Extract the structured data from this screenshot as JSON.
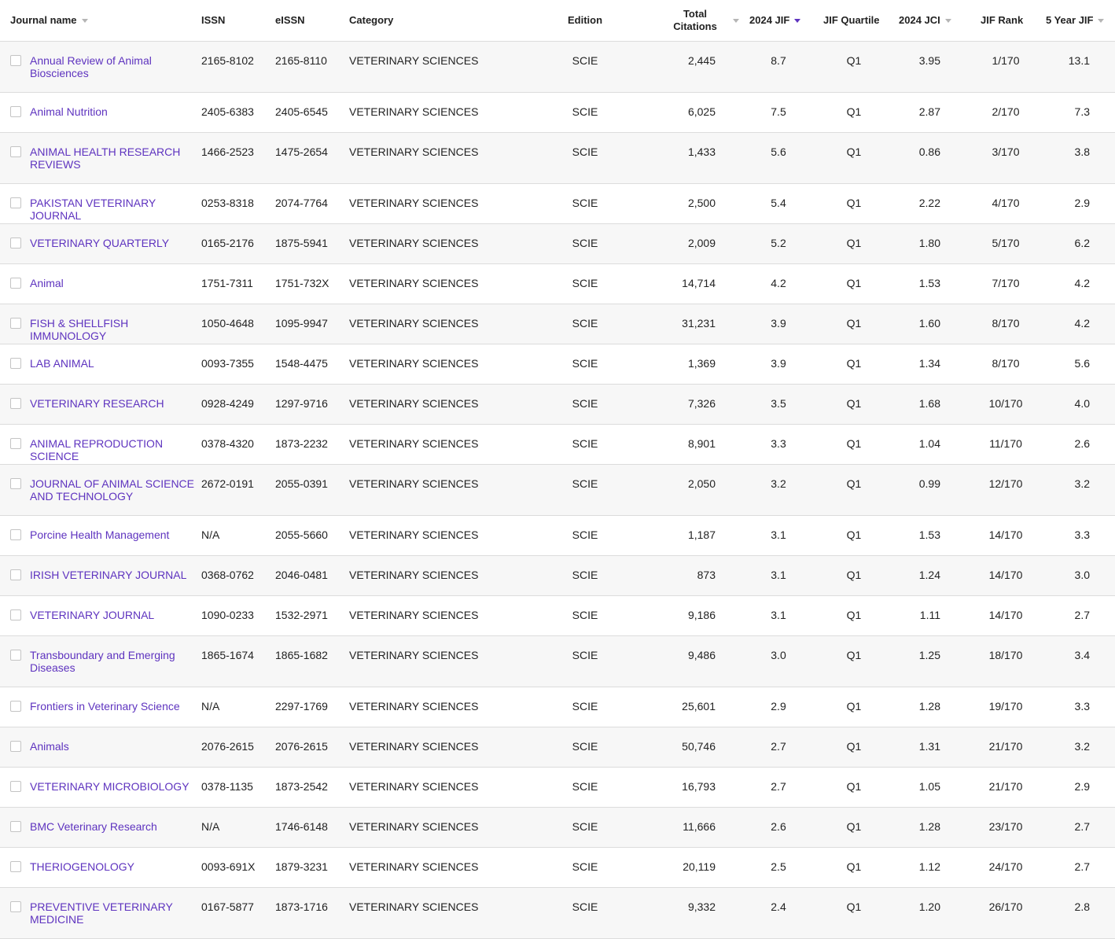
{
  "columns": {
    "journal_name": "Journal name",
    "issn": "ISSN",
    "eissn": "eISSN",
    "category": "Category",
    "edition": "Edition",
    "total_citations_line1": "Total",
    "total_citations_line2": "Citations",
    "jif": "2024 JIF",
    "jif_quartile": "JIF Quartile",
    "jci": "2024 JCI",
    "jif_rank": "JIF Rank",
    "five_year_jif": "5 Year JIF"
  },
  "rows": [
    {
      "name": "Annual Review of Animal Biosciences",
      "issn": "2165-8102",
      "eissn": "2165-8110",
      "category": "VETERINARY SCIENCES",
      "edition": "SCIE",
      "citations": "2,445",
      "jif": "8.7",
      "quartile": "Q1",
      "jci": "3.95",
      "rank": "1/170",
      "jif5": "13.1"
    },
    {
      "name": "Animal Nutrition",
      "issn": "2405-6383",
      "eissn": "2405-6545",
      "category": "VETERINARY SCIENCES",
      "edition": "SCIE",
      "citations": "6,025",
      "jif": "7.5",
      "quartile": "Q1",
      "jci": "2.87",
      "rank": "2/170",
      "jif5": "7.3"
    },
    {
      "name": "ANIMAL HEALTH RESEARCH REVIEWS",
      "issn": "1466-2523",
      "eissn": "1475-2654",
      "category": "VETERINARY SCIENCES",
      "edition": "SCIE",
      "citations": "1,433",
      "jif": "5.6",
      "quartile": "Q1",
      "jci": "0.86",
      "rank": "3/170",
      "jif5": "3.8"
    },
    {
      "name": "PAKISTAN VETERINARY JOURNAL",
      "issn": "0253-8318",
      "eissn": "2074-7764",
      "category": "VETERINARY SCIENCES",
      "edition": "SCIE",
      "citations": "2,500",
      "jif": "5.4",
      "quartile": "Q1",
      "jci": "2.22",
      "rank": "4/170",
      "jif5": "2.9"
    },
    {
      "name": "VETERINARY QUARTERLY",
      "issn": "0165-2176",
      "eissn": "1875-5941",
      "category": "VETERINARY SCIENCES",
      "edition": "SCIE",
      "citations": "2,009",
      "jif": "5.2",
      "quartile": "Q1",
      "jci": "1.80",
      "rank": "5/170",
      "jif5": "6.2"
    },
    {
      "name": "Animal",
      "issn": "1751-7311",
      "eissn": "1751-732X",
      "category": "VETERINARY SCIENCES",
      "edition": "SCIE",
      "citations": "14,714",
      "jif": "4.2",
      "quartile": "Q1",
      "jci": "1.53",
      "rank": "7/170",
      "jif5": "4.2"
    },
    {
      "name": "FISH & SHELLFISH IMMUNOLOGY",
      "issn": "1050-4648",
      "eissn": "1095-9947",
      "category": "VETERINARY SCIENCES",
      "edition": "SCIE",
      "citations": "31,231",
      "jif": "3.9",
      "quartile": "Q1",
      "jci": "1.60",
      "rank": "8/170",
      "jif5": "4.2"
    },
    {
      "name": "LAB ANIMAL",
      "issn": "0093-7355",
      "eissn": "1548-4475",
      "category": "VETERINARY SCIENCES",
      "edition": "SCIE",
      "citations": "1,369",
      "jif": "3.9",
      "quartile": "Q1",
      "jci": "1.34",
      "rank": "8/170",
      "jif5": "5.6"
    },
    {
      "name": "VETERINARY RESEARCH",
      "issn": "0928-4249",
      "eissn": "1297-9716",
      "category": "VETERINARY SCIENCES",
      "edition": "SCIE",
      "citations": "7,326",
      "jif": "3.5",
      "quartile": "Q1",
      "jci": "1.68",
      "rank": "10/170",
      "jif5": "4.0"
    },
    {
      "name": "ANIMAL REPRODUCTION SCIENCE",
      "issn": "0378-4320",
      "eissn": "1873-2232",
      "category": "VETERINARY SCIENCES",
      "edition": "SCIE",
      "citations": "8,901",
      "jif": "3.3",
      "quartile": "Q1",
      "jci": "1.04",
      "rank": "11/170",
      "jif5": "2.6"
    },
    {
      "name": "JOURNAL OF ANIMAL SCIENCE AND TECHNOLOGY",
      "issn": "2672-0191",
      "eissn": "2055-0391",
      "category": "VETERINARY SCIENCES",
      "edition": "SCIE",
      "citations": "2,050",
      "jif": "3.2",
      "quartile": "Q1",
      "jci": "0.99",
      "rank": "12/170",
      "jif5": "3.2"
    },
    {
      "name": "Porcine Health Management",
      "issn": "N/A",
      "eissn": "2055-5660",
      "category": "VETERINARY SCIENCES",
      "edition": "SCIE",
      "citations": "1,187",
      "jif": "3.1",
      "quartile": "Q1",
      "jci": "1.53",
      "rank": "14/170",
      "jif5": "3.3"
    },
    {
      "name": "IRISH VETERINARY JOURNAL",
      "issn": "0368-0762",
      "eissn": "2046-0481",
      "category": "VETERINARY SCIENCES",
      "edition": "SCIE",
      "citations": "873",
      "jif": "3.1",
      "quartile": "Q1",
      "jci": "1.24",
      "rank": "14/170",
      "jif5": "3.0"
    },
    {
      "name": "VETERINARY JOURNAL",
      "issn": "1090-0233",
      "eissn": "1532-2971",
      "category": "VETERINARY SCIENCES",
      "edition": "SCIE",
      "citations": "9,186",
      "jif": "3.1",
      "quartile": "Q1",
      "jci": "1.11",
      "rank": "14/170",
      "jif5": "2.7"
    },
    {
      "name": "Transboundary and Emerging Diseases",
      "issn": "1865-1674",
      "eissn": "1865-1682",
      "category": "VETERINARY SCIENCES",
      "edition": "SCIE",
      "citations": "9,486",
      "jif": "3.0",
      "quartile": "Q1",
      "jci": "1.25",
      "rank": "18/170",
      "jif5": "3.4"
    },
    {
      "name": "Frontiers in Veterinary Science",
      "issn": "N/A",
      "eissn": "2297-1769",
      "category": "VETERINARY SCIENCES",
      "edition": "SCIE",
      "citations": "25,601",
      "jif": "2.9",
      "quartile": "Q1",
      "jci": "1.28",
      "rank": "19/170",
      "jif5": "3.3"
    },
    {
      "name": "Animals",
      "issn": "2076-2615",
      "eissn": "2076-2615",
      "category": "VETERINARY SCIENCES",
      "edition": "SCIE",
      "citations": "50,746",
      "jif": "2.7",
      "quartile": "Q1",
      "jci": "1.31",
      "rank": "21/170",
      "jif5": "3.2"
    },
    {
      "name": "VETERINARY MICROBIOLOGY",
      "issn": "0378-1135",
      "eissn": "1873-2542",
      "category": "VETERINARY SCIENCES",
      "edition": "SCIE",
      "citations": "16,793",
      "jif": "2.7",
      "quartile": "Q1",
      "jci": "1.05",
      "rank": "21/170",
      "jif5": "2.9"
    },
    {
      "name": "BMC Veterinary Research",
      "issn": "N/A",
      "eissn": "1746-6148",
      "category": "VETERINARY SCIENCES",
      "edition": "SCIE",
      "citations": "11,666",
      "jif": "2.6",
      "quartile": "Q1",
      "jci": "1.28",
      "rank": "23/170",
      "jif5": "2.7"
    },
    {
      "name": "THERIOGENOLOGY",
      "issn": "0093-691X",
      "eissn": "1879-3231",
      "category": "VETERINARY SCIENCES",
      "edition": "SCIE",
      "citations": "20,119",
      "jif": "2.5",
      "quartile": "Q1",
      "jci": "1.12",
      "rank": "24/170",
      "jif5": "2.7"
    },
    {
      "name": "PREVENTIVE VETERINARY MEDICINE",
      "issn": "0167-5877",
      "eissn": "1873-1716",
      "category": "VETERINARY SCIENCES",
      "edition": "SCIE",
      "citations": "9,332",
      "jif": "2.4",
      "quartile": "Q1",
      "jci": "1.20",
      "rank": "26/170",
      "jif5": "2.8"
    }
  ],
  "colors": {
    "link": "#5e33bf",
    "row_alt": "#f7f7f7",
    "divider": "#dcdcdc",
    "sort_active": "#5e33bf",
    "sort_inactive": "#b5b5b5"
  }
}
